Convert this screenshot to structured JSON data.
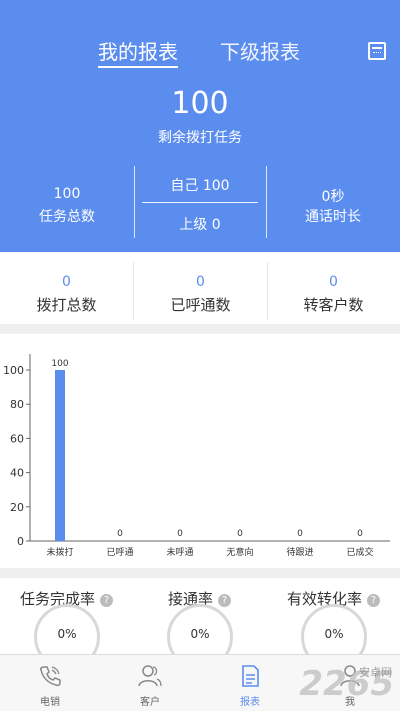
{
  "header": {
    "tabs": [
      {
        "label": "我的报表",
        "active": true
      },
      {
        "label": "下级报表",
        "active": false
      }
    ],
    "remaining_count": "100",
    "remaining_label": "剩余拨打任务",
    "total_tasks_value": "100",
    "total_tasks_label": "任务总数",
    "self_text": "自己  100",
    "superior_text": "上级  0",
    "talk_time_value": "0秒",
    "talk_time_label": "通话时长"
  },
  "counts": [
    {
      "value": "0",
      "label": "拨打总数"
    },
    {
      "value": "0",
      "label": "已呼通数"
    },
    {
      "value": "0",
      "label": "转客户数"
    }
  ],
  "chart_data": {
    "type": "bar",
    "categories": [
      "未拨打",
      "已呼通",
      "未呼通",
      "无意向",
      "待跟进",
      "已成交"
    ],
    "values": [
      100,
      0,
      0,
      0,
      0,
      0
    ],
    "ylim": [
      0,
      100
    ],
    "yticks": [
      0,
      20,
      40,
      60,
      80,
      100
    ],
    "bar_color": "#5b8def",
    "grid": false,
    "title": "",
    "xlabel": "",
    "ylabel": ""
  },
  "rates": [
    {
      "label": "任务完成率",
      "value": "0%"
    },
    {
      "label": "接通率",
      "value": "0%"
    },
    {
      "label": "有效转化率",
      "value": "0%"
    }
  ],
  "help_glyph": "?",
  "nav": [
    {
      "label": "电销",
      "icon": "phone-icon",
      "active": false
    },
    {
      "label": "客户",
      "icon": "users-icon",
      "active": false
    },
    {
      "label": "报表",
      "icon": "report-icon",
      "active": true
    },
    {
      "label": "我",
      "icon": "person-icon",
      "active": false
    }
  ],
  "colors": {
    "primary": "#5b8def",
    "divider": "#efefef"
  },
  "watermark": {
    "text": "2265",
    "sub": "安卓网"
  }
}
